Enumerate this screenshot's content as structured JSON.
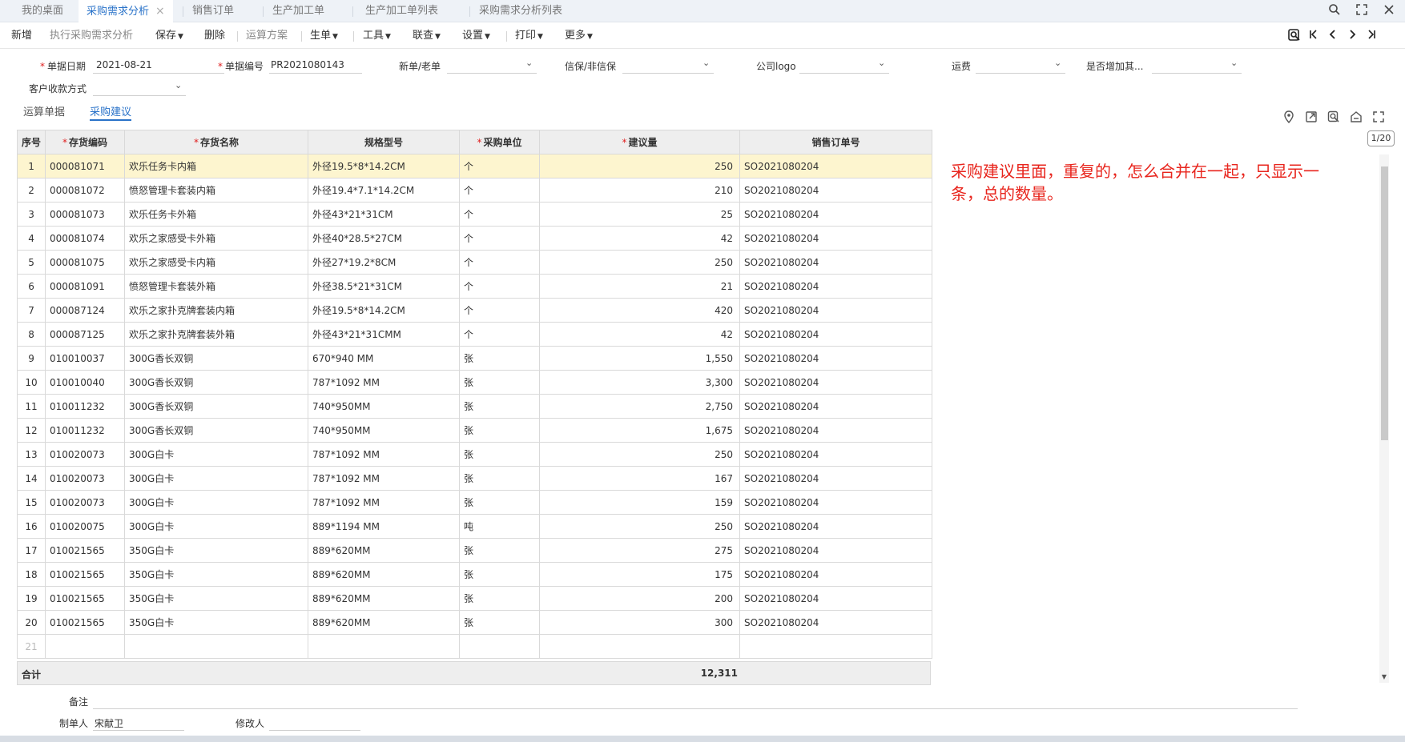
{
  "tabs": [
    {
      "label": "我的桌面"
    },
    {
      "label": "采购需求分析"
    },
    {
      "label": "销售订单"
    },
    {
      "label": "生产加工单"
    },
    {
      "label": "生产加工单列表"
    },
    {
      "label": "采购需求分析列表"
    }
  ],
  "tab_close": "×",
  "toolbar": {
    "new": "新增",
    "execute": "执行采购需求分析",
    "save": "保存",
    "delete": "删除",
    "calc_plan": "运算方案",
    "generate": "生单",
    "tools": "工具",
    "link_query": "联查",
    "settings": "设置",
    "print": "打印",
    "more": "更多"
  },
  "form": {
    "doc_date_label": "单据日期",
    "doc_date_value": "2021-08-21",
    "doc_no_label": "单据编号",
    "doc_no_value": "PR2021080143",
    "new_old_label": "新单/老单",
    "credit_label": "信保/非信保",
    "logo_label": "公司logo",
    "freight_label": "运费",
    "add_label": "是否增加其...",
    "payment_label": "客户收款方式"
  },
  "subtabs": {
    "calc_docs": "运算单据",
    "suggestion": "采购建议"
  },
  "pager": "1/20",
  "table": {
    "headers": {
      "no": "序号",
      "code": "存货编码",
      "name": "存货名称",
      "spec": "规格型号",
      "unit": "采购单位",
      "qty": "建议量",
      "so": "销售订单号"
    },
    "rows": [
      {
        "no": "1",
        "code": "000081071",
        "name": "欢乐任务卡内箱",
        "spec": "外径19.5*8*14.2CM",
        "unit": "个",
        "qty": "250",
        "so": "SO2021080204"
      },
      {
        "no": "2",
        "code": "000081072",
        "name": "愤怒管理卡套装内箱",
        "spec": "外径19.4*7.1*14.2CM",
        "unit": "个",
        "qty": "210",
        "so": "SO2021080204"
      },
      {
        "no": "3",
        "code": "000081073",
        "name": "欢乐任务卡外箱",
        "spec": "外径43*21*31CM",
        "unit": "个",
        "qty": "25",
        "so": "SO2021080204"
      },
      {
        "no": "4",
        "code": "000081074",
        "name": "欢乐之家感受卡外箱",
        "spec": "外径40*28.5*27CM",
        "unit": "个",
        "qty": "42",
        "so": "SO2021080204"
      },
      {
        "no": "5",
        "code": "000081075",
        "name": "欢乐之家感受卡内箱",
        "spec": "外径27*19.2*8CM",
        "unit": "个",
        "qty": "250",
        "so": "SO2021080204"
      },
      {
        "no": "6",
        "code": "000081091",
        "name": "愤怒管理卡套装外箱",
        "spec": "外径38.5*21*31CM",
        "unit": "个",
        "qty": "21",
        "so": "SO2021080204"
      },
      {
        "no": "7",
        "code": "000087124",
        "name": "欢乐之家扑克牌套装内箱",
        "spec": "外径19.5*8*14.2CM",
        "unit": "个",
        "qty": "420",
        "so": "SO2021080204"
      },
      {
        "no": "8",
        "code": "000087125",
        "name": "欢乐之家扑克牌套装外箱",
        "spec": "外径43*21*31CMM",
        "unit": "个",
        "qty": "42",
        "so": "SO2021080204"
      },
      {
        "no": "9",
        "code": "010010037",
        "name": "300G香长双铜",
        "spec": "670*940 MM",
        "unit": "张",
        "qty": "1,550",
        "so": "SO2021080204"
      },
      {
        "no": "10",
        "code": "010010040",
        "name": "300G香长双铜",
        "spec": "787*1092 MM",
        "unit": "张",
        "qty": "3,300",
        "so": "SO2021080204"
      },
      {
        "no": "11",
        "code": "010011232",
        "name": "300G香长双铜",
        "spec": "740*950MM",
        "unit": "张",
        "qty": "2,750",
        "so": "SO2021080204"
      },
      {
        "no": "12",
        "code": "010011232",
        "name": "300G香长双铜",
        "spec": "740*950MM",
        "unit": "张",
        "qty": "1,675",
        "so": "SO2021080204"
      },
      {
        "no": "13",
        "code": "010020073",
        "name": "300G白卡",
        "spec": "787*1092 MM",
        "unit": "张",
        "qty": "250",
        "so": "SO2021080204"
      },
      {
        "no": "14",
        "code": "010020073",
        "name": "300G白卡",
        "spec": "787*1092 MM",
        "unit": "张",
        "qty": "167",
        "so": "SO2021080204"
      },
      {
        "no": "15",
        "code": "010020073",
        "name": "300G白卡",
        "spec": "787*1092 MM",
        "unit": "张",
        "qty": "159",
        "so": "SO2021080204"
      },
      {
        "no": "16",
        "code": "010020075",
        "name": "300G白卡",
        "spec": "889*1194 MM",
        "unit": "吨",
        "qty": "250",
        "so": "SO2021080204"
      },
      {
        "no": "17",
        "code": "010021565",
        "name": "350G白卡",
        "spec": "889*620MM",
        "unit": "张",
        "qty": "275",
        "so": "SO2021080204"
      },
      {
        "no": "18",
        "code": "010021565",
        "name": "350G白卡",
        "spec": "889*620MM",
        "unit": "张",
        "qty": "175",
        "so": "SO2021080204"
      },
      {
        "no": "19",
        "code": "010021565",
        "name": "350G白卡",
        "spec": "889*620MM",
        "unit": "张",
        "qty": "200",
        "so": "SO2021080204"
      },
      {
        "no": "20",
        "code": "010021565",
        "name": "350G白卡",
        "spec": "889*620MM",
        "unit": "张",
        "qty": "300",
        "so": "SO2021080204"
      }
    ],
    "empty_row_no": "21",
    "sum_label": "合计",
    "sum_value": "12,311"
  },
  "annotation": "采购建议里面，重复的，怎么合并在一起，只显示一条，总的数量。",
  "footer": {
    "remark_label": "备注",
    "creator_label": "制单人",
    "creator_value": "宋献卫",
    "modifier_label": "修改人"
  },
  "colors": {
    "accent": "#2a73c9",
    "required": "#e02020",
    "selected_row": "#fdf5cf",
    "annotation": "#e8251d"
  }
}
